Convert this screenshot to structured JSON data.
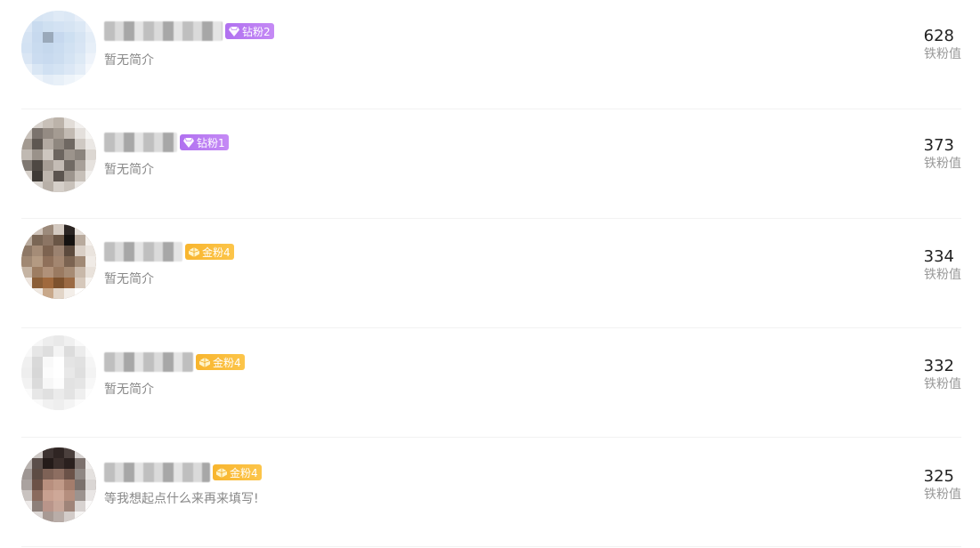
{
  "fans": [
    {
      "badge": {
        "label": "钻粉2",
        "tier": "diamond",
        "color": "#b070f0"
      },
      "intro": "暂无简介",
      "score": "628",
      "score_label": "铁粉值"
    },
    {
      "badge": {
        "label": "钻粉1",
        "tier": "diamond",
        "color": "#b070f0"
      },
      "intro": "暂无简介",
      "score": "373",
      "score_label": "铁粉值"
    },
    {
      "badge": {
        "label": "金粉4",
        "tier": "gold",
        "color": "#f8b52e"
      },
      "intro": "暂无简介",
      "score": "334",
      "score_label": "铁粉值"
    },
    {
      "badge": {
        "label": "金粉4",
        "tier": "gold",
        "color": "#f8b52e"
      },
      "intro": "暂无简介",
      "score": "332",
      "score_label": "铁粉值"
    },
    {
      "badge": {
        "label": "金粉4",
        "tier": "gold",
        "color": "#f8b52e"
      },
      "intro": "等我想起点什么来再来填写!",
      "score": "325",
      "score_label": "铁粉值"
    }
  ]
}
